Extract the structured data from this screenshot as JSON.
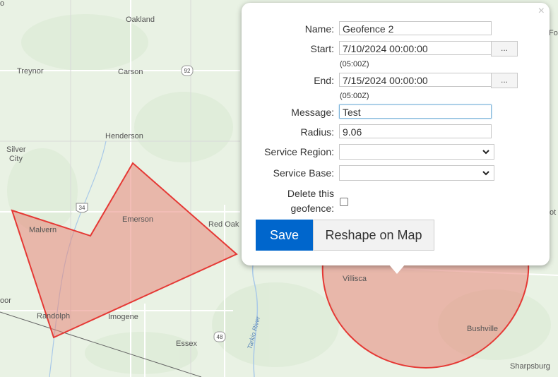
{
  "map": {
    "places": {
      "oakland": "Oakland",
      "treynor": "Treynor",
      "carson": "Carson",
      "henderson": "Henderson",
      "silver_city_1": "Silver",
      "silver_city_2": "City",
      "malvern": "Malvern",
      "emerson": "Emerson",
      "red_oak": "Red Oak",
      "randolph": "Randolph",
      "imogene": "Imogene",
      "essex": "Essex",
      "villisca": "Villisca",
      "bushville": "Bushville",
      "sharpsburg": "Sharpsburg",
      "edge_top_left": "o",
      "edge_left": "oor",
      "edge_right_top": "Fo",
      "edge_right_mid": "ot"
    },
    "river_label": "Tarkio River",
    "shields": {
      "hwy92": "92",
      "hwy34": "34",
      "hwy48": "48"
    },
    "geofence_fill": "#e8877a",
    "geofence_stroke": "#e53935"
  },
  "popup": {
    "close_label": "×",
    "name_label": "Name:",
    "name_value": "Geofence 2",
    "start_label": "Start:",
    "start_value": "7/10/2024 00:00:00",
    "start_tz": "(05:00Z)",
    "end_label": "End:",
    "end_value": "7/15/2024 00:00:00",
    "end_tz": "(05:00Z)",
    "picker_label": "...",
    "message_label": "Message:",
    "message_value": "Test",
    "radius_label": "Radius:",
    "radius_value": "9.06",
    "service_region_label": "Service Region:",
    "service_region_value": "",
    "service_base_label": "Service Base:",
    "service_base_value": "",
    "delete_label_1": "Delete this",
    "delete_label_2": "geofence:",
    "save_label": "Save",
    "reshape_label": "Reshape on Map"
  }
}
